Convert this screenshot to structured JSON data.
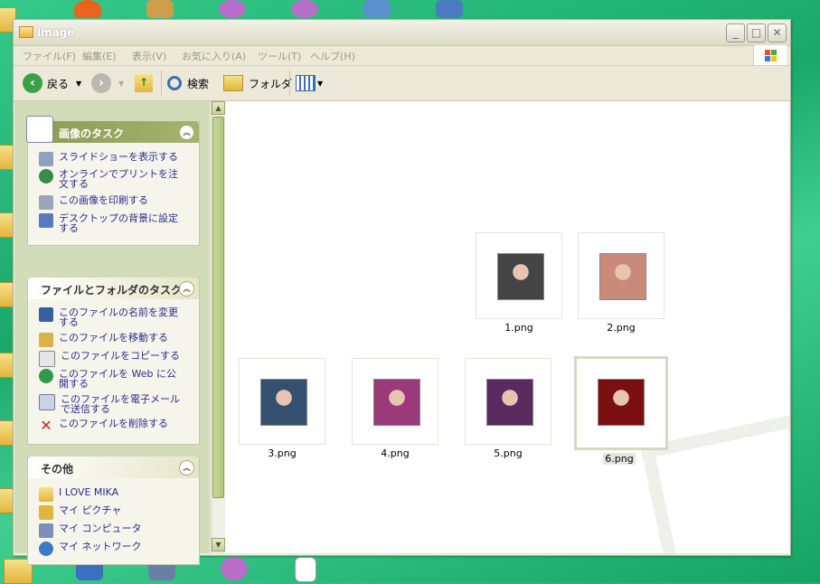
{
  "window": {
    "title": "image"
  },
  "menu": [
    "ファイル(F)",
    "編集(E)",
    "表示(V)",
    "お気に入り(A)",
    "ツール(T)",
    "ヘルプ(H)"
  ],
  "toolbar": {
    "back": "戻る",
    "search": "検索",
    "folder": "フォルダ"
  },
  "panels": {
    "image_tasks": {
      "title": "画像のタスク",
      "items": [
        "スライドショーを表示する",
        "オンラインでプリントを注文する",
        "この画像を印刷する",
        "デスクトップの背景に設定する"
      ]
    },
    "file_tasks": {
      "title": "ファイルとフォルダのタスク",
      "items": [
        "このファイルの名前を変更する",
        "このファイルを移動する",
        "このファイルをコピーする",
        "このファイルを Web に公開する",
        "このファイルを電子メールで送信する",
        "このファイルを削除する"
      ]
    },
    "other": {
      "title": "その他",
      "items": [
        "I LOVE MIKA",
        "マイ ピクチャ",
        "マイ コンピュータ",
        "マイ ネットワーク"
      ]
    }
  },
  "files": [
    {
      "name": "1.png",
      "color": "#444444"
    },
    {
      "name": "2.png",
      "color": "#c98a7a"
    },
    {
      "name": "3.png",
      "color": "#34506e"
    },
    {
      "name": "4.png",
      "color": "#9a3a7a"
    },
    {
      "name": "5.png",
      "color": "#5a2a60"
    },
    {
      "name": "6.png",
      "color": "#7a1010"
    }
  ]
}
